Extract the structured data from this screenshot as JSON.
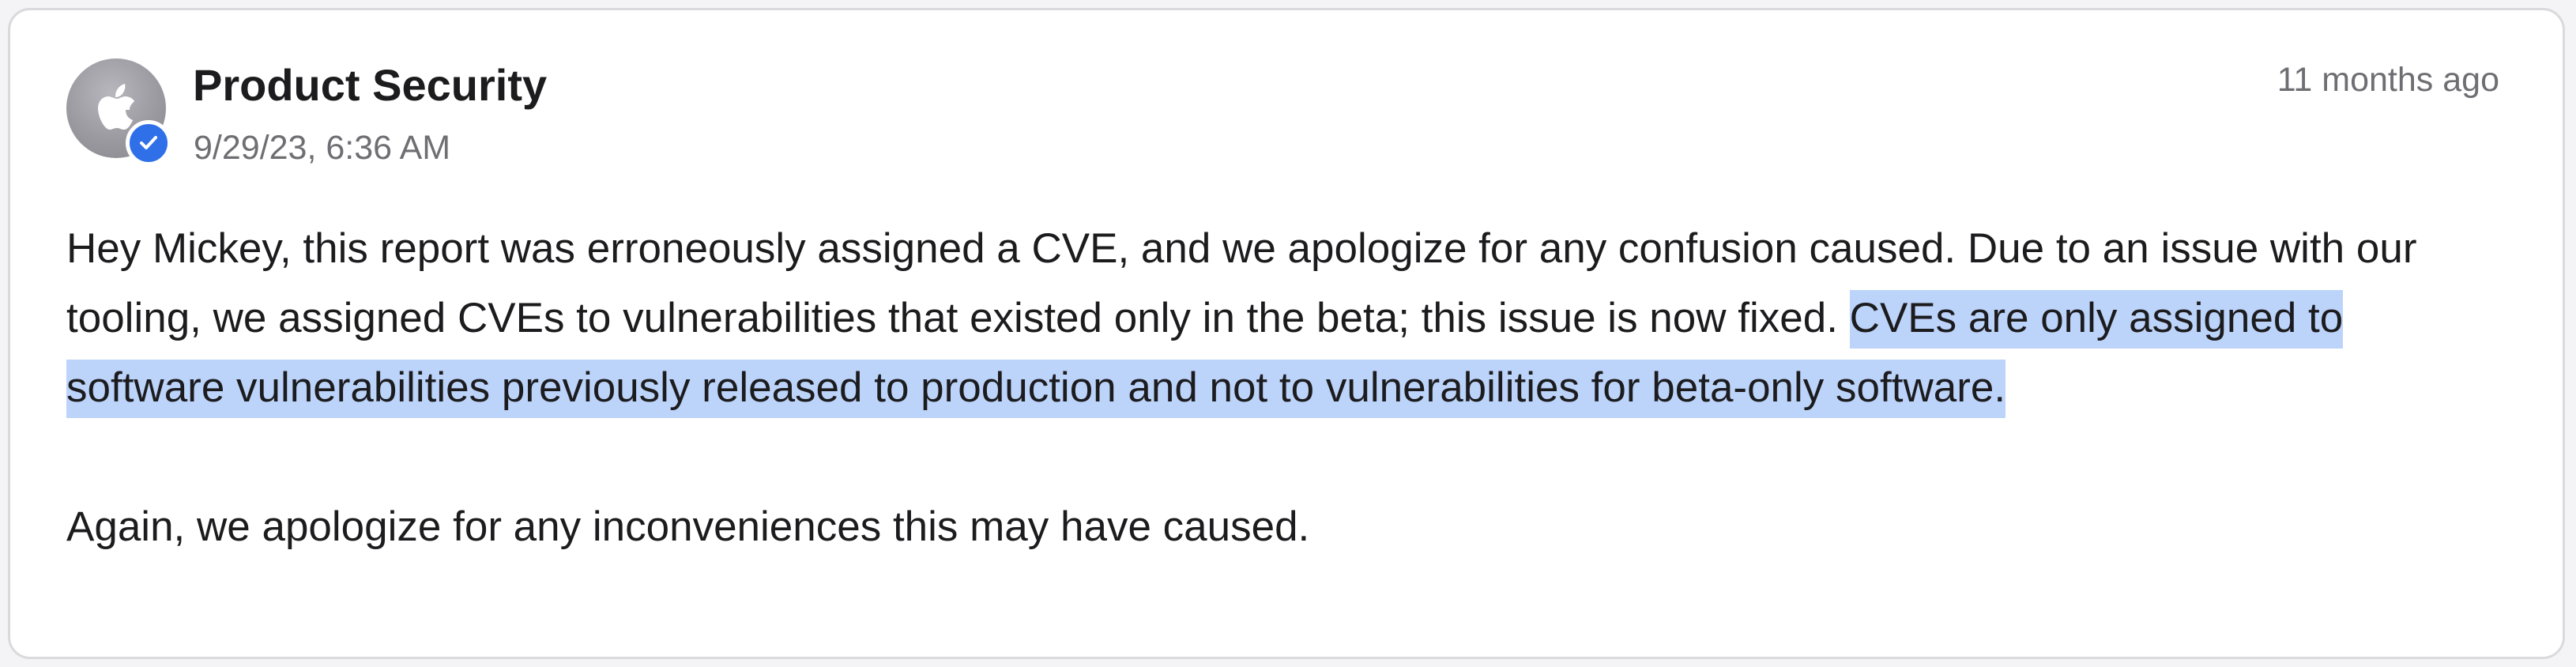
{
  "comment": {
    "author": "Product Security",
    "timestamp": "9/29/23, 6:36 AM",
    "relative_time": "11 months ago",
    "avatar_icon": "apple-logo-icon",
    "verified_icon": "checkmark-icon",
    "paragraph1_plain": "Hey Mickey, this report was erroneously assigned a CVE, and we apologize for any confusion caused. Due to an issue with our tooling, we assigned CVEs to vulnerabilities that existed only in the beta; this issue is now fixed. ",
    "paragraph1_selected": "CVEs are only assigned to software vulnerabilities previously released to production and not to vulnerabilities for beta-only software.",
    "paragraph2": "Again, we apologize for any inconveniences this may have caused."
  },
  "colors": {
    "accent": "#2f6fe8",
    "selection": "#bcd3fa",
    "text": "#1c1c1e",
    "muted": "#6e6e73"
  }
}
